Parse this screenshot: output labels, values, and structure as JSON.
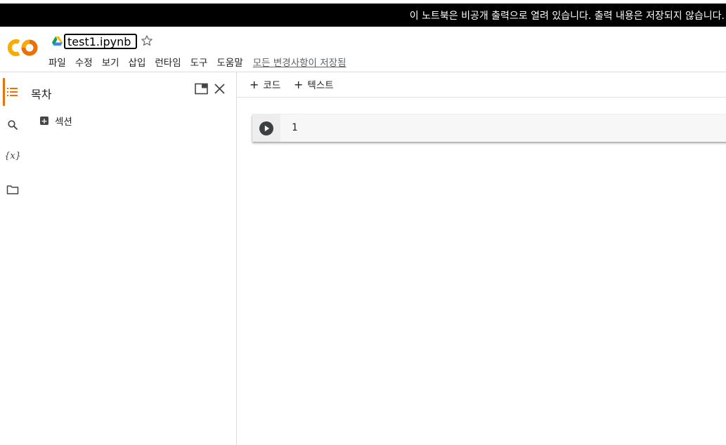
{
  "banner": {
    "text": "이 노트북은 비공개 출력으로 열려 있습니다. 출력 내용은 저장되지 않습니다."
  },
  "header": {
    "notebook_name": "test1.ipynb",
    "menu": [
      "파일",
      "수정",
      "보기",
      "삽입",
      "런타임",
      "도구",
      "도움말"
    ],
    "save_status": "모든 변경사항이 저장됨"
  },
  "sidebar": {
    "rail_icons": [
      "toc-icon",
      "search-icon",
      "variables-icon",
      "folder-icon"
    ],
    "variables_label": "{x}",
    "panel_title": "목차",
    "add_section_label": "섹션"
  },
  "toolbar": {
    "add_code_label": "코드",
    "add_text_label": "텍스트"
  },
  "cell": {
    "code": "1"
  },
  "colors": {
    "accent": "#e8710a",
    "logo_orange": "#f9ab00",
    "logo_dark_orange": "#e8710a",
    "banner_bg": "#000000"
  }
}
